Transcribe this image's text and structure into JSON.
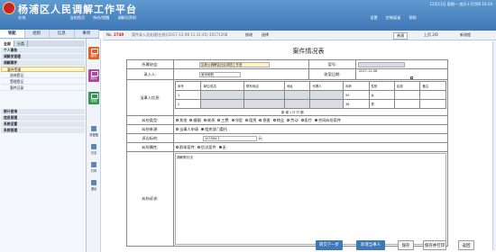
{
  "app": {
    "title": "杨浦区人民调解工作平台",
    "clock": "12月11日 星期一 农历十月廿四 16:24"
  },
  "toolbar": {
    "online": "在线",
    "items": [
      "当前首页",
      "待办/提醒",
      "调解员资料"
    ],
    "right_items": [
      "设置",
      "控制面板",
      "帮助"
    ]
  },
  "left_tabs": [
    "导航",
    "组织",
    "信息",
    "事项"
  ],
  "sidebar": {
    "tabs": [
      "全部",
      "分类"
    ],
    "rows": [
      {
        "label": "个人事务",
        "type": "grp"
      },
      {
        "label": "调解员管理",
        "type": "grp"
      },
      {
        "label": "调解案件",
        "type": "grp"
      },
      {
        "label": "案件受理",
        "type": "act"
      },
      {
        "label": "咨询登记",
        "type": "sub"
      },
      {
        "label": "受理登记",
        "type": "sub"
      },
      {
        "label": "案件记录",
        "type": "sub"
      },
      {
        "label": "统计查询",
        "type": "grp"
      },
      {
        "label": "信息管理",
        "type": "grp"
      },
      {
        "label": "系统设置",
        "type": "grp"
      },
      {
        "label": "系统管理",
        "type": "grp"
      }
    ]
  },
  "tiles": [
    {
      "label": "案件",
      "color": "#e0632a"
    },
    {
      "label": "附件",
      "color": "#b0479e"
    },
    {
      "label": "存档",
      "color": "#2f9a4f"
    }
  ],
  "side_icons": [
    "流程图",
    "日志",
    "打印",
    "退出"
  ],
  "doc_tab": {
    "no_label": "No.",
    "no_value": "2749",
    "desc": "案件录入及处理(在线)(2017-12-08 11:31:45) 20171208",
    "modify": "修改",
    "select": "选择",
    "view": "普通",
    "page": "上页 2/0",
    "flow": "新流程"
  },
  "form": {
    "title": "案件情况表",
    "org_label": "所属协会:",
    "org_value": "区新公调解会社区调查工作室",
    "case_no_label": "案号:",
    "case_no_value": "",
    "recorder_label": "录入人:",
    "recorder_value": "吴玛莉勤",
    "accept_date_label": "收案日期:",
    "accept_date_value": "2017-12-08",
    "parties_label": "当事人信息:",
    "party_headers": [
      "序号",
      "单位/姓名",
      "联系电话",
      "地址",
      "代理人",
      "年龄",
      "性别",
      "民族",
      "备注"
    ],
    "party_rows": [
      [
        "1",
        "",
        "",
        "",
        "",
        "50",
        "女",
        "",
        ""
      ],
      [
        "2",
        "",
        "",
        "",
        "",
        "36",
        "男",
        "",
        ""
      ]
    ],
    "party_footer": "新 增  1  行  行  删",
    "dispute_type_label": "纠纷类型:",
    "dispute_types": [
      "其他",
      "婚姻",
      "继承",
      "三费",
      "邻里",
      "租赁",
      "损害",
      "物业",
      "劳动",
      "医疗",
      "合同纠纷案件"
    ],
    "dispute_source_label": "纠纷来源:",
    "dispute_sources": [
      "当事人申请",
      "相关部门委托"
    ],
    "dispute_amount_label": "诉讼标的:",
    "dispute_amount_value": "107584.1",
    "dispute_amount_unit": "元",
    "dispute_nature_label": "纠纷属性:",
    "dispute_natures": [
      "群体案件",
      "信访案件",
      "无"
    ],
    "claim_label": "纠纷诉求:",
    "claim_value": "调解情况(无"
  },
  "buttons": [
    "转交下一步",
    "新增当事人",
    "保存",
    "保存并打印",
    "返回"
  ]
}
